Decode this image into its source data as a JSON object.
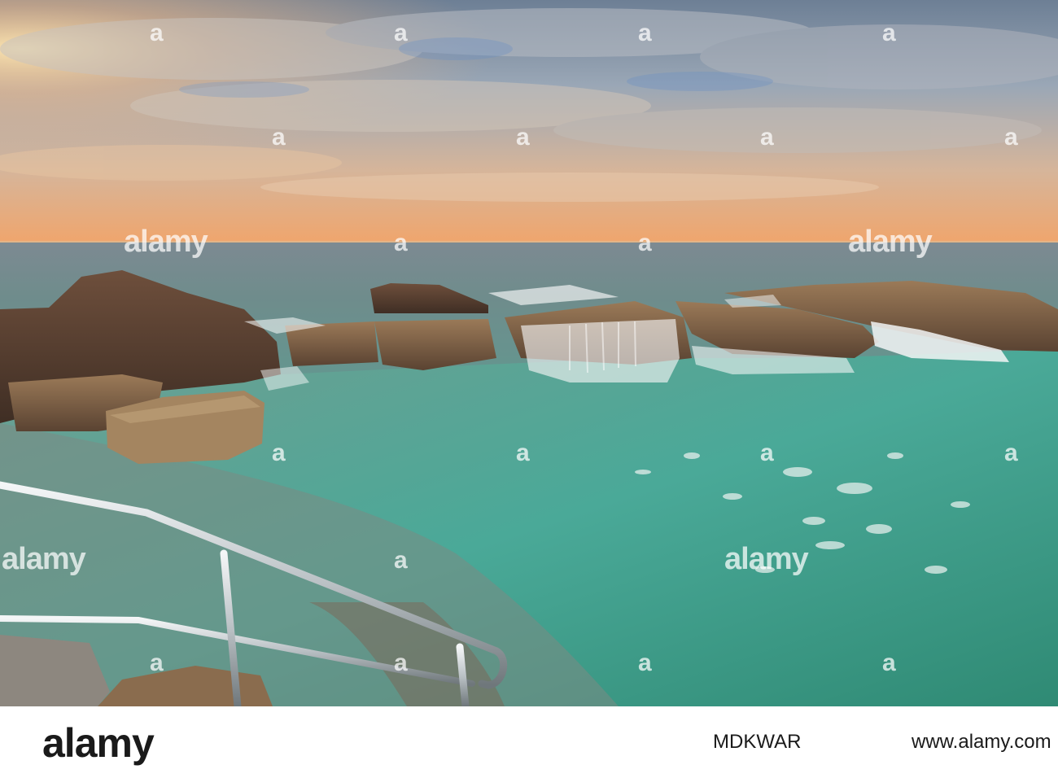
{
  "watermark": {
    "brand": "alamy",
    "mark": "a"
  },
  "footer": {
    "logo": "alamy",
    "image_id": "MDKWAR",
    "url": "www.alamy.com"
  },
  "colors": {
    "sky_warm": "#f2a46a",
    "sky_cool": "#8fa6bd",
    "sea_teal": "#4fa89a",
    "rock": "#8b6c4e",
    "foam": "#f2f4f4"
  }
}
